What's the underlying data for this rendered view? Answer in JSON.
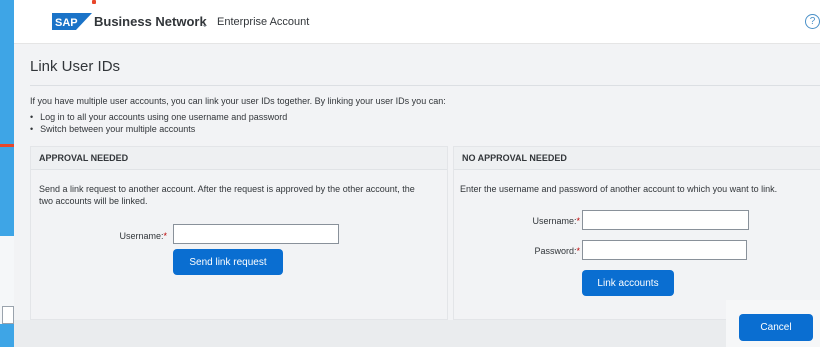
{
  "header": {
    "brand": "Business Network",
    "brand_caret": "⌄",
    "account": "Enterprise Account",
    "help_glyph": "?"
  },
  "page": {
    "title": "Link User IDs",
    "intro": "If you have multiple user accounts, you can link your user IDs together. By linking your user IDs you can:",
    "bullets": [
      "Log in to all your accounts using one username and password",
      "Switch between your multiple accounts"
    ]
  },
  "approval_panel": {
    "header": "APPROVAL NEEDED",
    "description_line1": "Send a link request to another account. After the request is approved by the other account, the",
    "description_line2": "two accounts will be linked.",
    "username_label": "Username:",
    "required_mark": "*",
    "username_value": "",
    "submit_label": "Send link request"
  },
  "no_approval_panel": {
    "header": "NO APPROVAL NEEDED",
    "description": "Enter the username and password of another account to which you want to link.",
    "username_label": "Username:",
    "password_label": "Password:",
    "required_mark": "*",
    "username_value": "",
    "password_value": "",
    "submit_label": "Link accounts"
  },
  "footer": {
    "cancel_label": "Cancel"
  },
  "colors": {
    "primary": "#0a6ed1",
    "desktop_bg": "#2b9be3",
    "sap_logo": "#1a73c8"
  },
  "icons": {
    "logo": "sap-logo",
    "help": "help-icon"
  }
}
